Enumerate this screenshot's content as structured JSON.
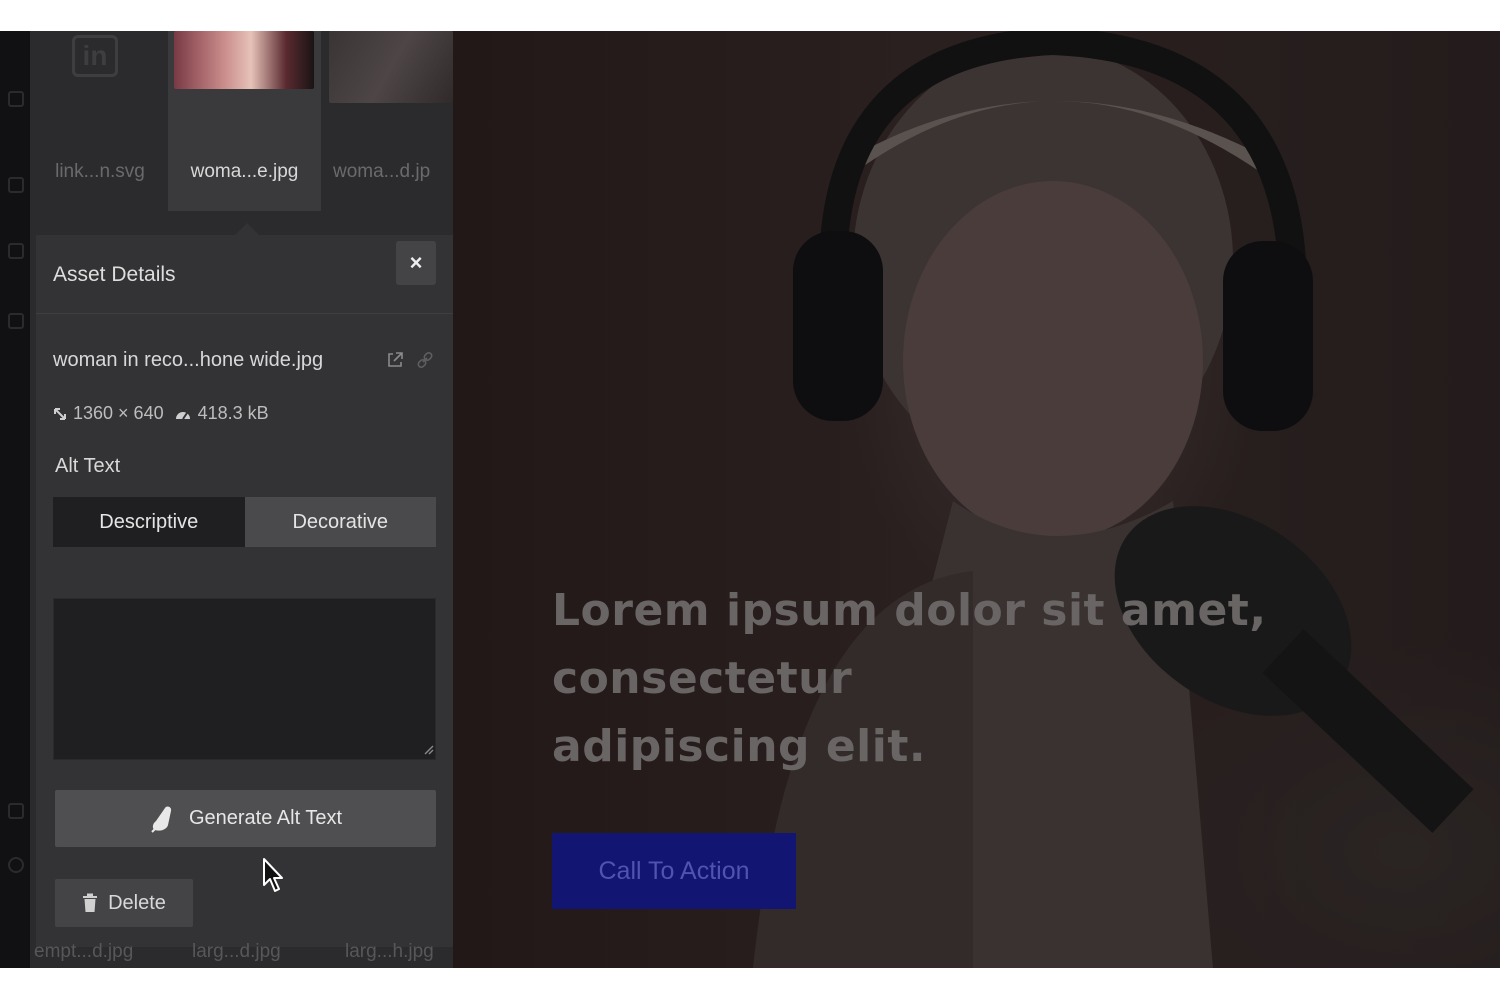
{
  "thumbnails": [
    {
      "name": "link...n.svg",
      "selected": false,
      "icon": "linkedin-logo"
    },
    {
      "name": "woma...e.jpg",
      "selected": true
    },
    {
      "name": "woma...d.jp",
      "selected": false
    }
  ],
  "asset_details": {
    "title": "Asset Details",
    "close_label": "×",
    "file_name": "woman in reco...hone wide.jpg",
    "dimensions": "1360 × 640",
    "file_size": "418.3 kB",
    "alt_text_label": "Alt Text",
    "alt_modes": [
      "Descriptive",
      "Decorative"
    ],
    "alt_mode_selected": "Descriptive",
    "alt_text_value": "",
    "generate_label": "Generate Alt Text",
    "delete_label": "Delete"
  },
  "bottom_thumbnails": [
    "empt...d.jpg",
    "larg...d.jpg",
    "larg...h.jpg"
  ],
  "preview": {
    "heading_lines": [
      "Lorem ipsum dolor sit amet,",
      "consectetur",
      "adipiscing elit."
    ],
    "cta_label": "Call To Action"
  },
  "colors": {
    "cta_background": "#121572",
    "panel_background": "#333335",
    "active_segment": "#1f1f21"
  }
}
